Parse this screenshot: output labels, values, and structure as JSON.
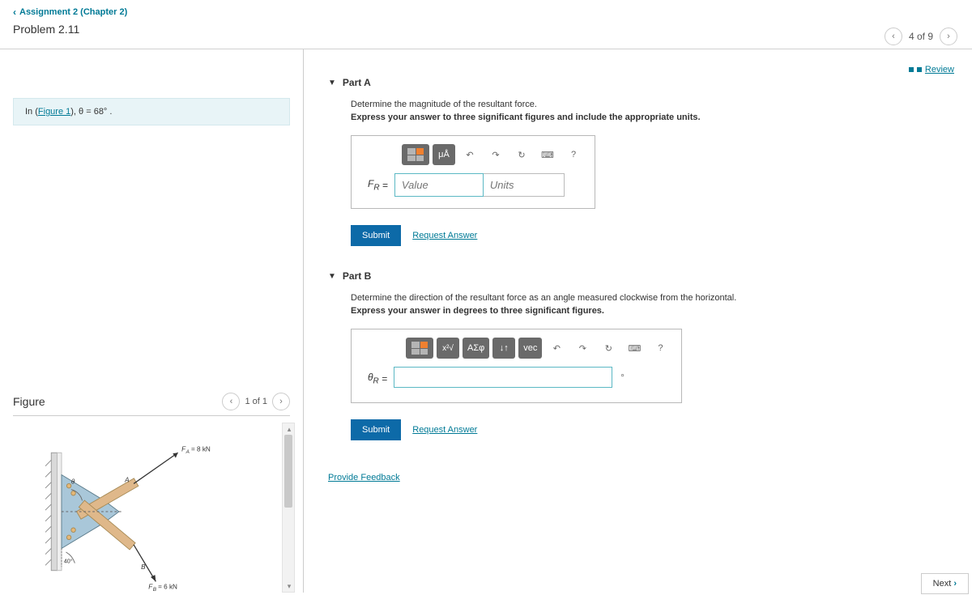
{
  "breadcrumb": {
    "label": "Assignment 2 (Chapter 2)"
  },
  "problem_title": "Problem 2.11",
  "page_nav": {
    "position": "4 of 9"
  },
  "review_link": "Review",
  "info": {
    "prefix": "In (",
    "link": "Figure 1",
    "suffix": "), θ = 68° ."
  },
  "figure": {
    "title": "Figure",
    "nav": "1 of 1",
    "labels": {
      "fa": "F_A = 8 kN",
      "fb": "F_B = 6 kN",
      "theta": "θ",
      "a": "A",
      "b": "B",
      "ang40": "40°"
    }
  },
  "partA": {
    "title": "Part A",
    "prompt1": "Determine the magnitude of the resultant force.",
    "prompt2": "Express your answer to three significant figures and include the appropriate units.",
    "var_label": "F_R =",
    "value_ph": "Value",
    "units_ph": "Units",
    "toolbar": {
      "units_btn": "μÅ",
      "undo": "↶",
      "redo": "↷",
      "reset": "↻",
      "kbd": "⌨",
      "help": "?"
    },
    "submit": "Submit",
    "request": "Request Answer"
  },
  "partB": {
    "title": "Part B",
    "prompt1": "Determine the direction of the resultant force as an angle measured clockwise from the horizontal.",
    "prompt2": "Express your answer in degrees to three significant figures.",
    "var_label": "θ_R =",
    "deg": "°",
    "toolbar": {
      "sqrt": "√x",
      "greek": "ΑΣφ",
      "arrows": "↓↑",
      "vec": "vec",
      "undo": "↶",
      "redo": "↷",
      "reset": "↻",
      "kbd": "⌨",
      "help": "?"
    },
    "submit": "Submit",
    "request": "Request Answer"
  },
  "feedback_link": "Provide Feedback",
  "next_btn": "Next"
}
